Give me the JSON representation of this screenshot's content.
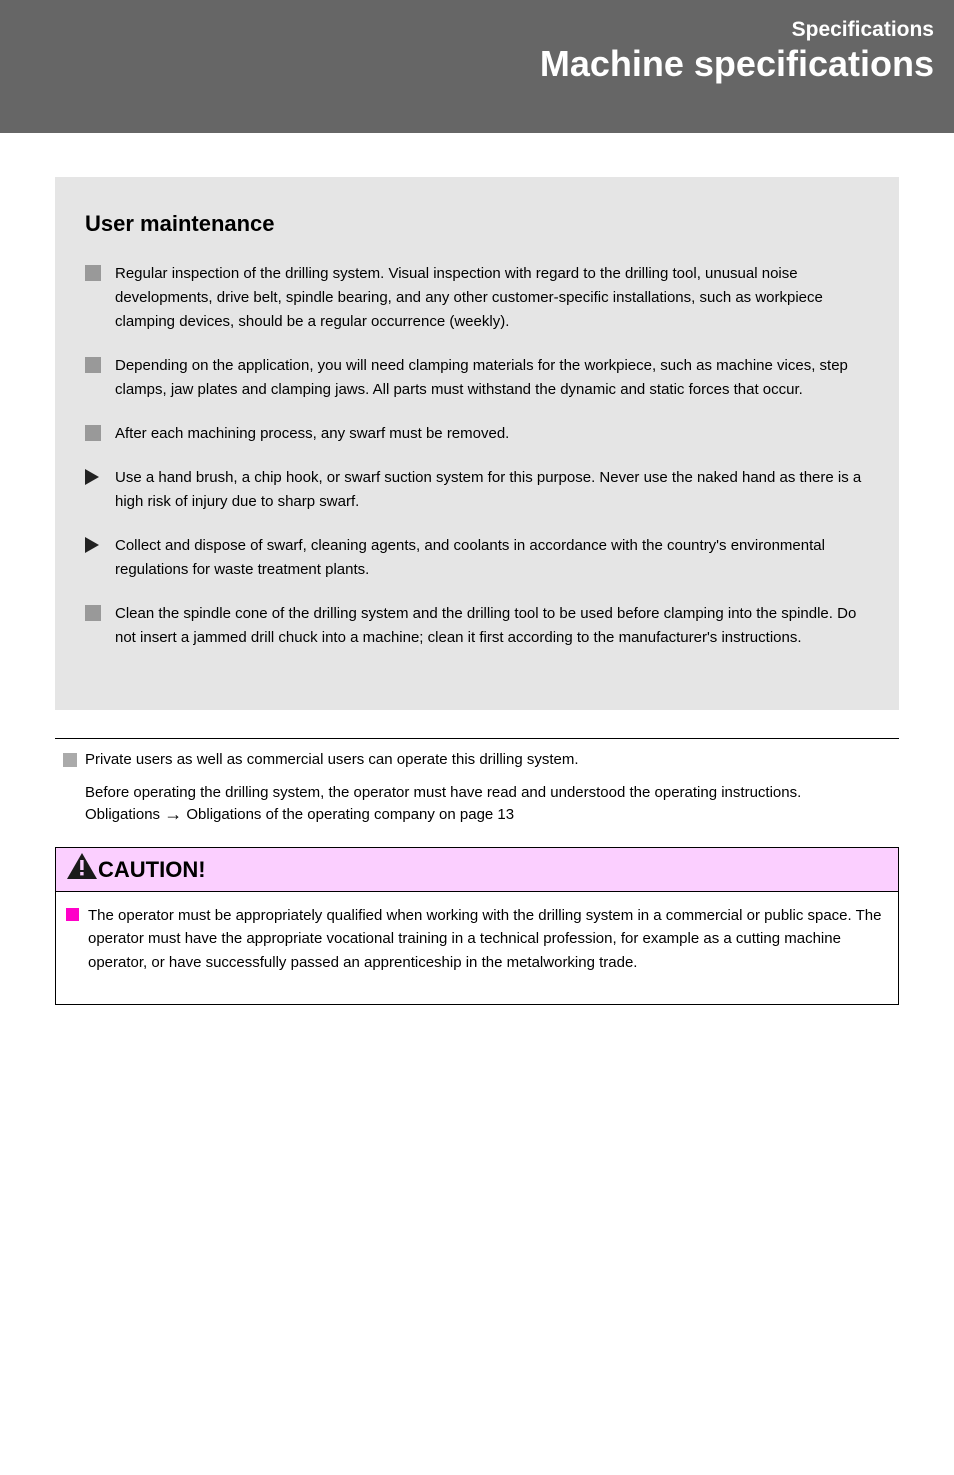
{
  "header": {
    "section": "Specifications",
    "title": "Machine specifications"
  },
  "box": {
    "title": "User maintenance",
    "items": [
      {
        "bullet": "square",
        "text": "Regular inspection of the drilling system. Visual inspection with regard to the drilling tool, unusual noise developments, drive belt, spindle bearing, and any other customer-specific installations, such as workpiece clamping devices, should be a regular occurrence (weekly)."
      },
      {
        "bullet": "square",
        "text": "Depending on the application, you will need clamping materials for the workpiece, such as machine vices, step clamps, jaw plates and clamping jaws. All parts must withstand the dynamic and static forces that occur."
      },
      {
        "bullet": "square",
        "text": "After each machining process, any swarf must be removed."
      },
      {
        "bullet": "triangle",
        "text": "Use a hand brush, a chip hook, or swarf suction system for this purpose. Never use the naked hand as there is a high risk of injury due to sharp swarf."
      },
      {
        "bullet": "triangle",
        "text": "Collect and dispose of swarf, cleaning agents, and coolants in accordance with the country's environmental regulations for waste treatment plants."
      },
      {
        "bullet": "square",
        "text": "Clean the spindle cone of the drilling system and the drilling tool to be used before clamping into the spindle. Do not insert a jammed drill chuck into a machine; clean it first according to the manufacturer's instructions."
      }
    ]
  },
  "operators": [
    "Private users as well as commercial users can operate this drilling system."
  ],
  "reference": {
    "text1": "Before operating the drilling system, the operator must have read and understood the operating instructions.",
    "text2": "Obligations ",
    "arrow": "→",
    "text3": " Obligations of the operating company on page 13"
  },
  "caution": {
    "label": "CAUTION!",
    "body": "The operator must be appropriately qualified when working with the drilling system in a commercial or public space. The operator must have the appropriate vocational training in a technical profession, for example as a cutting machine operator, or have successfully passed an apprenticeship in the metalworking trade."
  }
}
